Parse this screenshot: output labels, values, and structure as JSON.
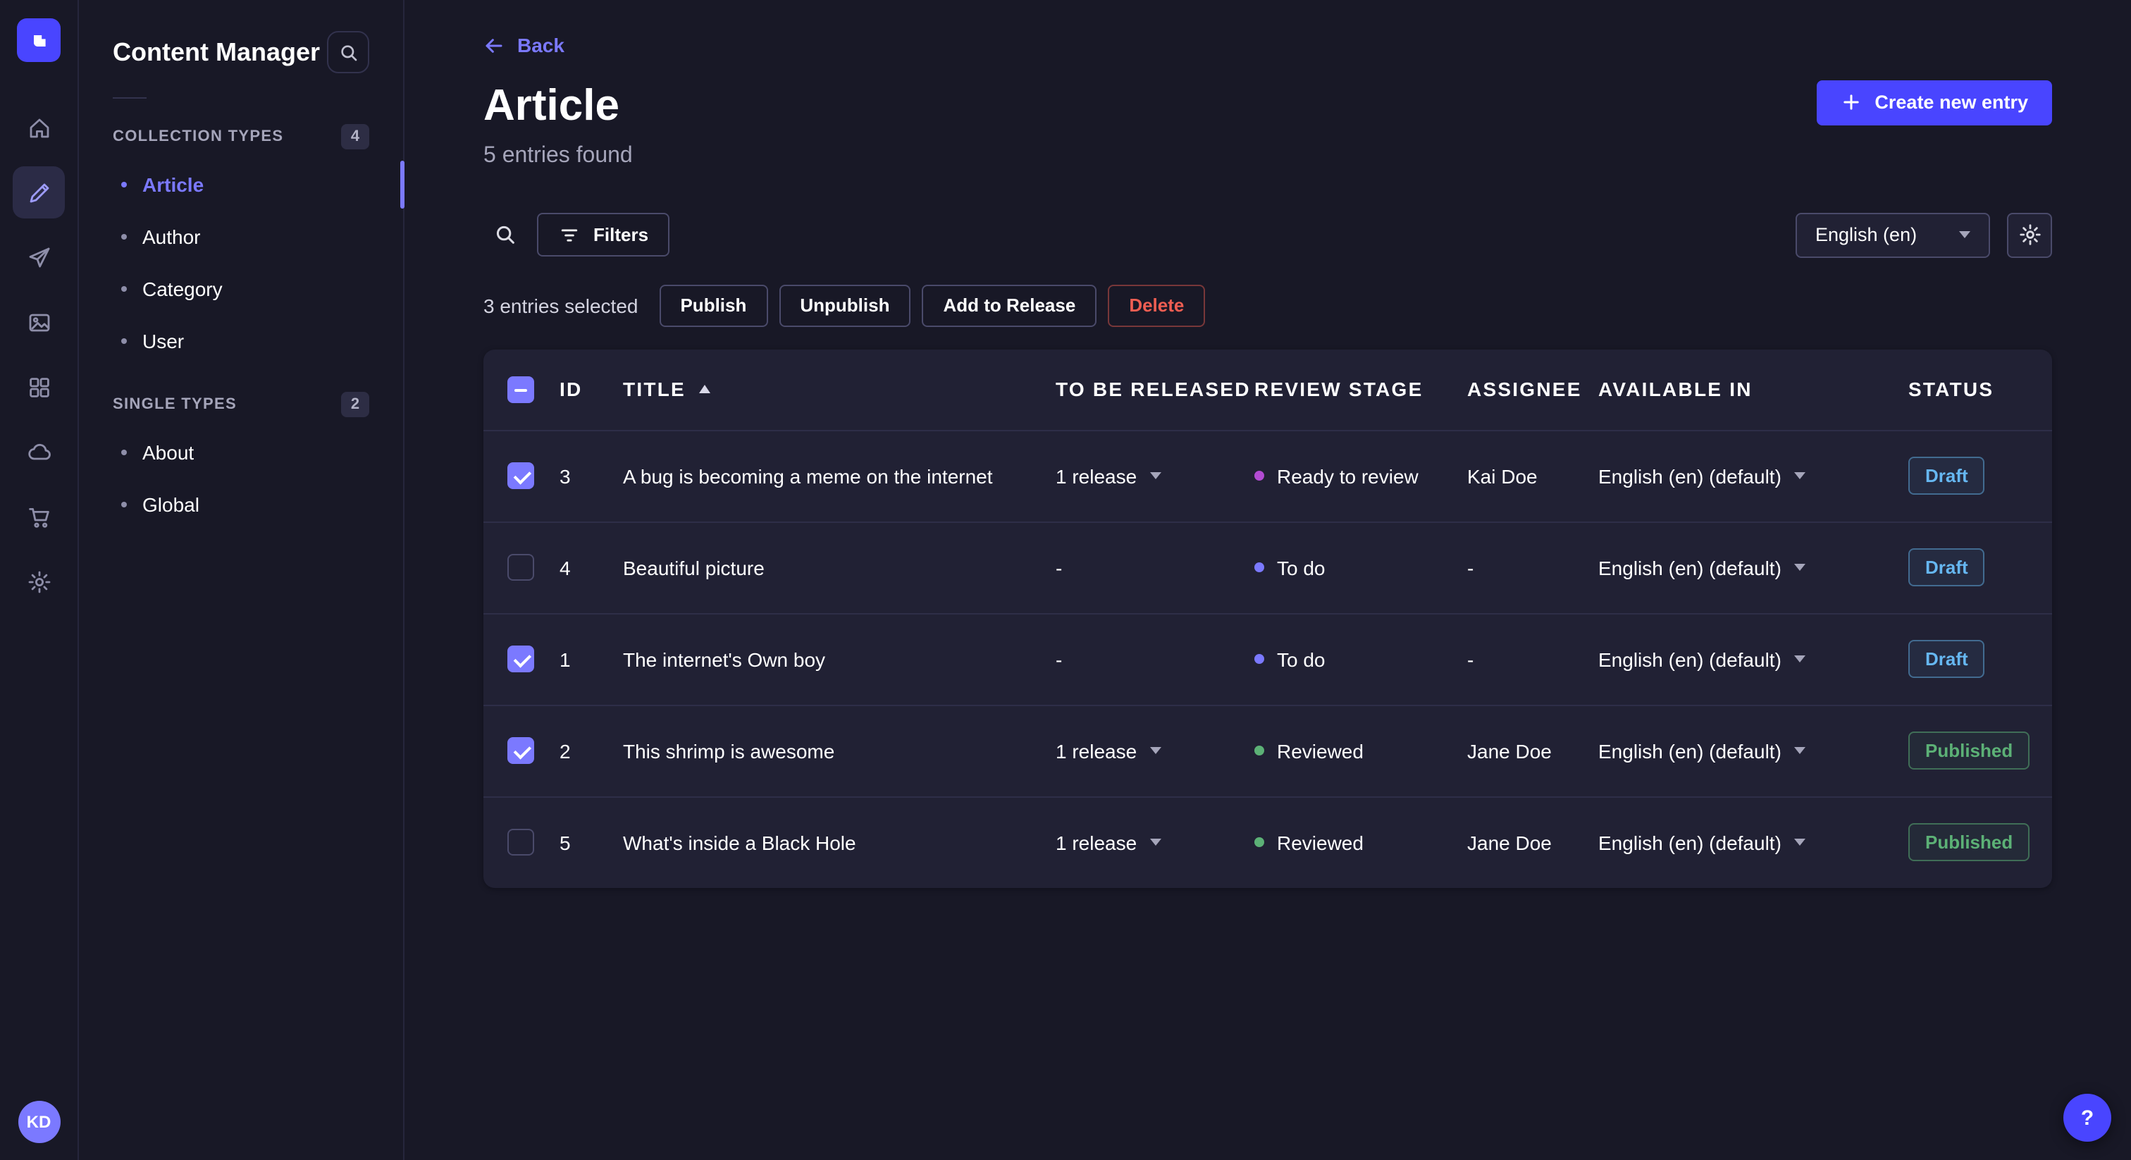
{
  "colors": {
    "brand": "#4945ff",
    "accent": "#7b79ff",
    "background": "#181826",
    "surface": "#212134",
    "border": "#32324d",
    "danger": "#ee5e52",
    "success": "#5cb176",
    "draft": "#66b7f1"
  },
  "icons": {
    "sidebar_search": "search-icon",
    "toolbar_search": "search-icon",
    "filters": "filter-icon",
    "locale_caret": "chevron-down-icon",
    "settings": "gear-icon",
    "create": "plus-icon",
    "back": "arrow-left-icon",
    "sort": "caret-up-icon",
    "help": "question-mark-icon"
  },
  "nav_rail": {
    "icons": [
      {
        "name": "home",
        "active": false
      },
      {
        "name": "content-manager",
        "active": true
      },
      {
        "name": "transfer",
        "active": false
      },
      {
        "name": "media-library",
        "active": false
      },
      {
        "name": "content-type-builder",
        "active": false
      },
      {
        "name": "cloud",
        "active": false
      },
      {
        "name": "marketplace",
        "active": false
      },
      {
        "name": "settings",
        "active": false
      }
    ],
    "avatar_initials": "KD"
  },
  "sidebar": {
    "title": "Content Manager",
    "sections": [
      {
        "label": "COLLECTION TYPES",
        "badge": "4",
        "items": [
          {
            "label": "Article",
            "active": true
          },
          {
            "label": "Author",
            "active": false
          },
          {
            "label": "Category",
            "active": false
          },
          {
            "label": "User",
            "active": false
          }
        ]
      },
      {
        "label": "SINGLE TYPES",
        "badge": "2",
        "items": [
          {
            "label": "About",
            "active": false
          },
          {
            "label": "Global",
            "active": false
          }
        ]
      }
    ]
  },
  "header": {
    "back": "Back",
    "title": "Article",
    "subtitle": "5 entries found",
    "create_button": "Create new entry"
  },
  "toolbar": {
    "filters": "Filters",
    "locale": "English (en)"
  },
  "selection": {
    "label": "3 entries selected",
    "publish": "Publish",
    "unpublish": "Unpublish",
    "add_to_release": "Add to Release",
    "delete": "Delete"
  },
  "table": {
    "header_indeterminate": true,
    "sort": {
      "column": "title",
      "direction": "ascending"
    },
    "columns": {
      "id": "ID",
      "title": "TITLE",
      "release": "TO BE RELEASED IN",
      "stage": "REVIEW STAGE",
      "assignee": "ASSIGNEE",
      "available": "AVAILABLE IN",
      "status": "STATUS"
    },
    "rows": [
      {
        "checked": true,
        "id": "3",
        "title": "A bug is becoming a meme on the internet",
        "release": "1 release",
        "has_release_menu": true,
        "stage": "Ready to review",
        "stage_color": "#b24bd2",
        "assignee": "Kai Doe",
        "available": "English (en) (default)",
        "status": "Draft",
        "status_color": "#66b7f1",
        "status_border": "rgba(102,183,241,0.45)",
        "status_bg": "rgba(102,183,241,0.07)"
      },
      {
        "checked": false,
        "id": "4",
        "title": "Beautiful picture",
        "release": "-",
        "has_release_menu": false,
        "stage": "To do",
        "stage_color": "#7b79ff",
        "assignee": "-",
        "available": "English (en) (default)",
        "status": "Draft",
        "status_color": "#66b7f1",
        "status_border": "rgba(102,183,241,0.45)",
        "status_bg": "rgba(102,183,241,0.07)"
      },
      {
        "checked": true,
        "id": "1",
        "title": "The internet's Own boy",
        "release": "-",
        "has_release_menu": false,
        "stage": "To do",
        "stage_color": "#7b79ff",
        "assignee": "-",
        "available": "English (en) (default)",
        "status": "Draft",
        "status_color": "#66b7f1",
        "status_border": "rgba(102,183,241,0.45)",
        "status_bg": "rgba(102,183,241,0.07)"
      },
      {
        "checked": true,
        "id": "2",
        "title": "This shrimp is awesome",
        "release": "1 release",
        "has_release_menu": true,
        "stage": "Reviewed",
        "stage_color": "#5cb176",
        "assignee": "Jane Doe",
        "available": "English (en) (default)",
        "status": "Published",
        "status_color": "#5cb176",
        "status_border": "rgba(92,177,118,0.5)",
        "status_bg": "rgba(92,177,118,0.07)"
      },
      {
        "checked": false,
        "id": "5",
        "title": "What's inside a Black Hole",
        "release": "1 release",
        "has_release_menu": true,
        "stage": "Reviewed",
        "stage_color": "#5cb176",
        "assignee": "Jane Doe",
        "available": "English (en) (default)",
        "status": "Published",
        "status_color": "#5cb176",
        "status_border": "rgba(92,177,118,0.5)",
        "status_bg": "rgba(92,177,118,0.07)"
      }
    ]
  },
  "help": {
    "label": "?"
  }
}
